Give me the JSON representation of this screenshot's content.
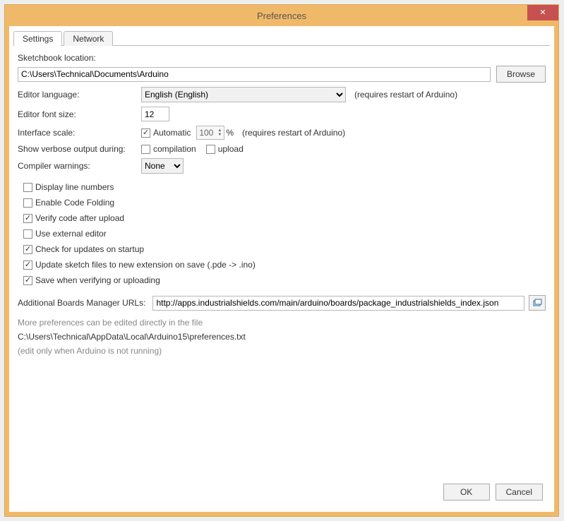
{
  "window": {
    "title": "Preferences"
  },
  "tabs": {
    "settings": "Settings",
    "network": "Network"
  },
  "sketchbook": {
    "label": "Sketchbook location:",
    "path": "C:\\Users\\Technical\\Documents\\Arduino",
    "browse": "Browse"
  },
  "editor_language": {
    "label": "Editor language:",
    "value": "English (English)",
    "hint": "(requires restart of Arduino)"
  },
  "editor_font": {
    "label": "Editor font size:",
    "value": "12"
  },
  "interface_scale": {
    "label": "Interface scale:",
    "automatic_label": "Automatic",
    "percent_value": "100",
    "percent_sign": "%",
    "hint": "(requires restart of Arduino)"
  },
  "verbose": {
    "label": "Show verbose output during:",
    "compilation": "compilation",
    "upload": "upload"
  },
  "compiler_warnings": {
    "label": "Compiler warnings:",
    "value": "None"
  },
  "options": {
    "display_line_numbers": "Display line numbers",
    "enable_code_folding": "Enable Code Folding",
    "verify_after_upload": "Verify code after upload",
    "use_external_editor": "Use external editor",
    "check_updates": "Check for updates on startup",
    "update_extension": "Update sketch files to new extension on save (.pde -> .ino)",
    "save_on_verify": "Save when verifying or uploading"
  },
  "boards_url": {
    "label": "Additional Boards Manager URLs:",
    "value": "http://apps.industrialshields.com/main/arduino/boards/package_industrialshields_index.json"
  },
  "footer": {
    "more_prefs": "More preferences can be edited directly in the file",
    "prefs_path": "C:\\Users\\Technical\\AppData\\Local\\Arduino15\\preferences.txt",
    "edit_note": "(edit only when Arduino is not running)"
  },
  "buttons": {
    "ok": "OK",
    "cancel": "Cancel"
  }
}
